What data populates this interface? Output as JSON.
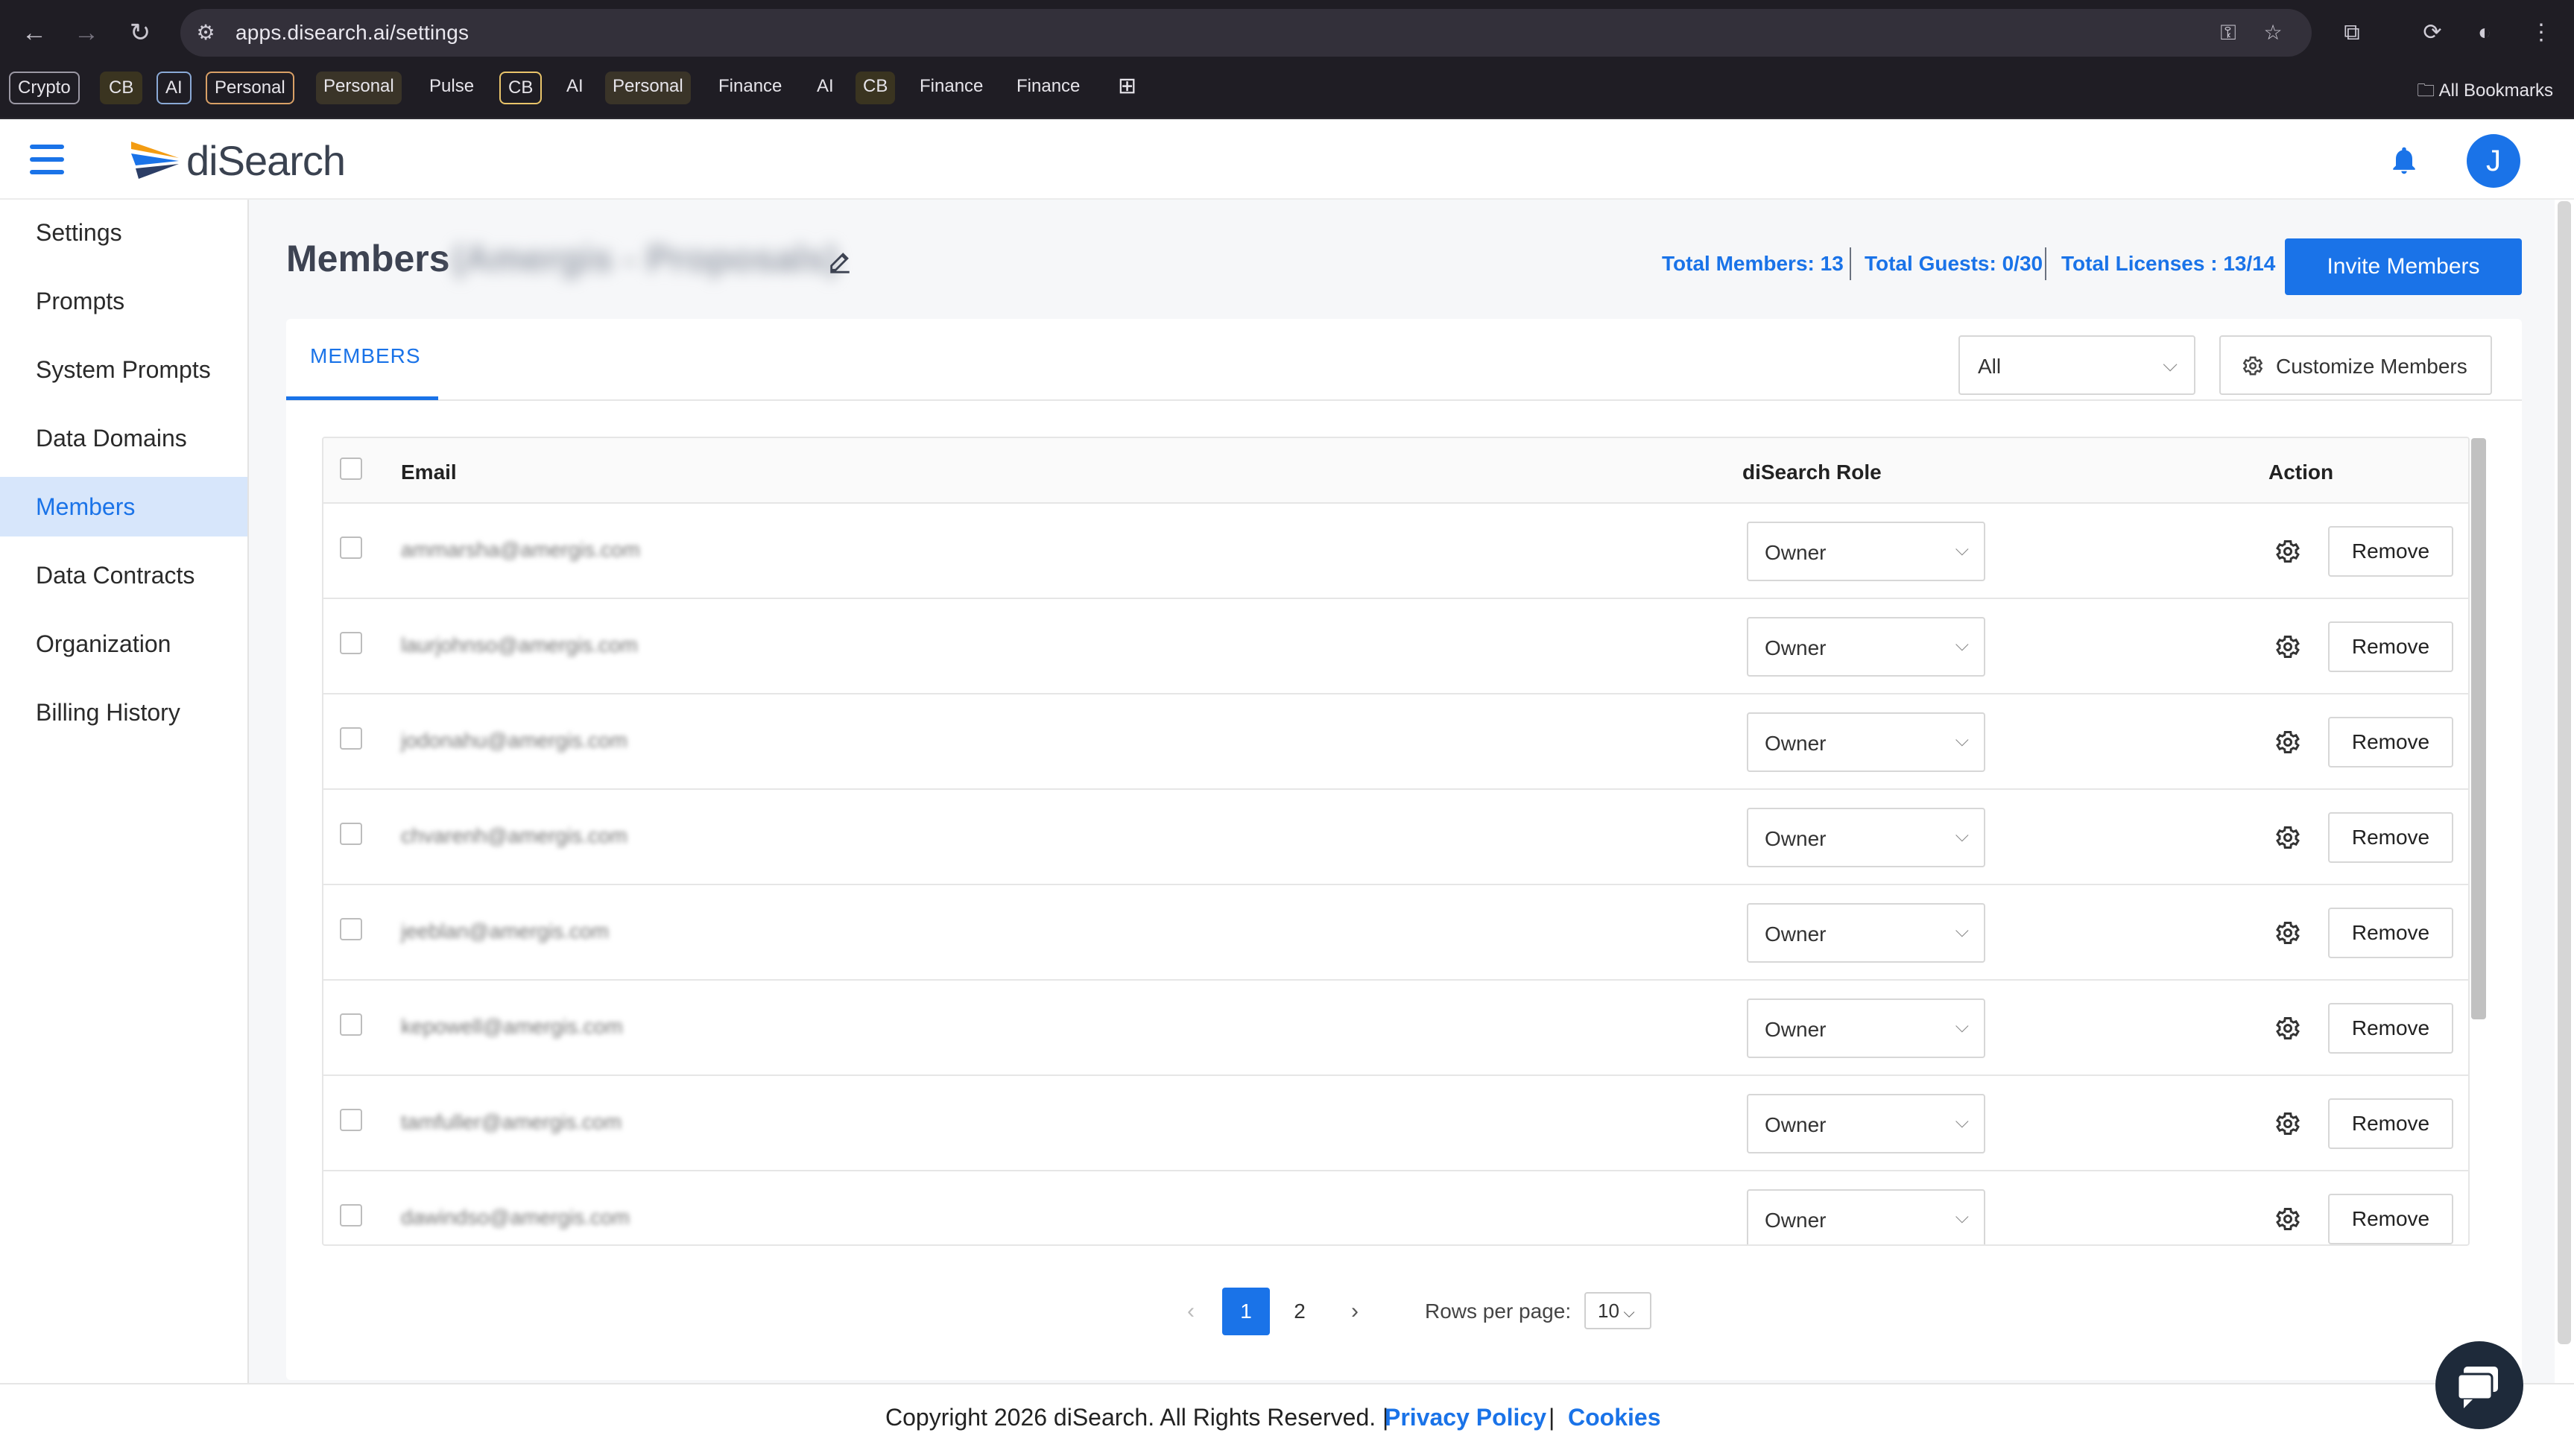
{
  "browser": {
    "url": "apps.disearch.ai/settings",
    "bookmarks": [
      "Crypto",
      "CB",
      "AI",
      "Personal",
      "Personal",
      "Pulse",
      "CB",
      "AI",
      "Personal",
      "Finance",
      "AI",
      "CB",
      "Finance",
      "Finance"
    ],
    "all_bookmarks": "All Bookmarks"
  },
  "app": {
    "logo_text": "diSearch",
    "avatar_initial": "J",
    "brand_color": "#1a73e8"
  },
  "sidebar": {
    "items": [
      {
        "label": "Settings"
      },
      {
        "label": "Prompts"
      },
      {
        "label": "System Prompts"
      },
      {
        "label": "Data Domains"
      },
      {
        "label": "Members",
        "active": true
      },
      {
        "label": "Data Contracts"
      },
      {
        "label": "Organization"
      },
      {
        "label": "Billing History"
      }
    ]
  },
  "header": {
    "title": "Members",
    "org_name_blurred": "(Amergis - Proposals)",
    "total_members": "Total Members: 13",
    "total_guests": "Total Guests: 0/30",
    "total_licenses": "Total Licenses : 13/14",
    "invite_label": "Invite Members"
  },
  "tabs": {
    "members": "MEMBERS"
  },
  "filter": {
    "value": "All",
    "customize_label": "Customize Members"
  },
  "table": {
    "columns": {
      "email": "Email",
      "role": "diSearch Role",
      "action": "Action"
    },
    "rows": [
      {
        "email": "ammarsha@amergis.com",
        "role": "Owner",
        "action": "Remove"
      },
      {
        "email": "laurjohnso@amergis.com",
        "role": "Owner",
        "action": "Remove"
      },
      {
        "email": "jodonahu@amergis.com",
        "role": "Owner",
        "action": "Remove"
      },
      {
        "email": "chvarenh@amergis.com",
        "role": "Owner",
        "action": "Remove"
      },
      {
        "email": "jeeblan@amergis.com",
        "role": "Owner",
        "action": "Remove"
      },
      {
        "email": "kepowell@amergis.com",
        "role": "Owner",
        "action": "Remove"
      },
      {
        "email": "tamfuller@amergis.com",
        "role": "Owner",
        "action": "Remove"
      },
      {
        "email": "dawindso@amergis.com",
        "role": "Owner",
        "action": "Remove"
      }
    ]
  },
  "pagination": {
    "pages": [
      "1",
      "2"
    ],
    "current": "1",
    "rows_per_page_label": "Rows per page:",
    "rows_per_page": "10"
  },
  "footer": {
    "copyright": "Copyright 2026 diSearch. All Rights Reserved. |",
    "privacy": "Privacy Policy",
    "separator": "|",
    "cookies": "Cookies"
  }
}
